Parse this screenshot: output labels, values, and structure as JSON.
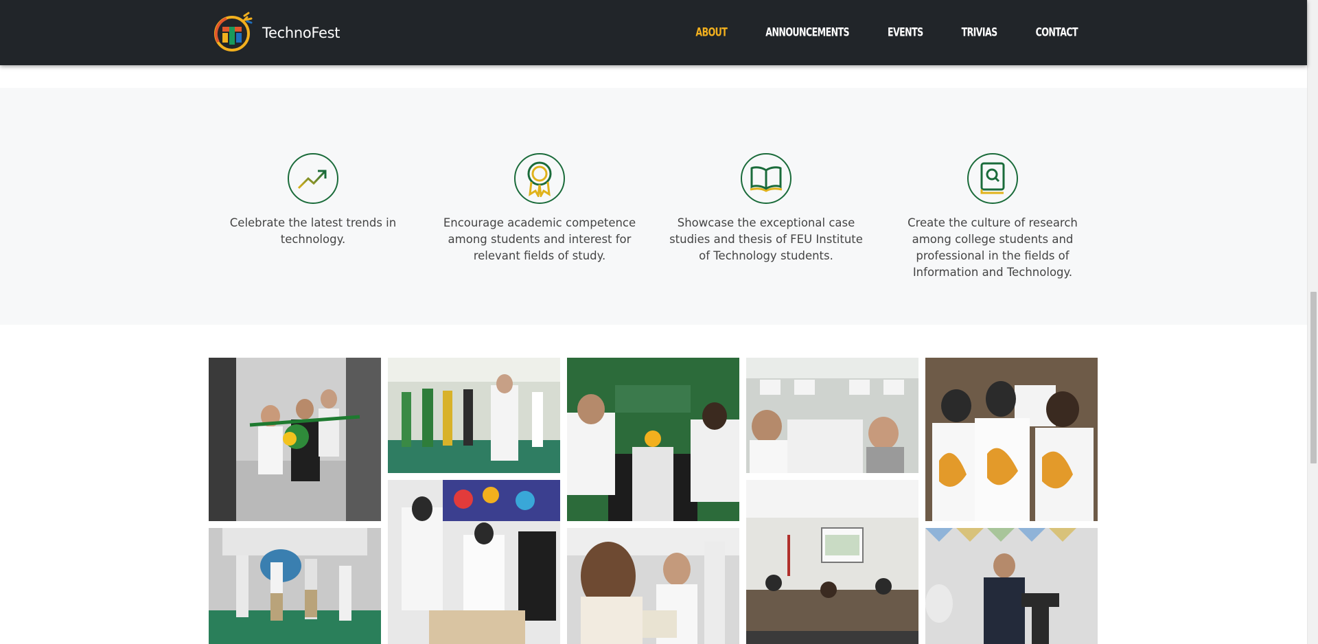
{
  "brand": {
    "name": "TechnoFest",
    "logo_icon": "technofest-logo-icon"
  },
  "nav": {
    "items": [
      {
        "label": "ABOUT",
        "active": true
      },
      {
        "label": "ANNOUNCEMENTS",
        "active": false
      },
      {
        "label": "EVENTS",
        "active": false
      },
      {
        "label": "TRIVIAS",
        "active": false
      },
      {
        "label": "CONTACT",
        "active": false
      }
    ]
  },
  "features": [
    {
      "icon": "trending-up-icon",
      "text": "Celebrate the latest trends in technology."
    },
    {
      "icon": "award-ribbon-icon",
      "text": "Encourage academic competence among students and interest for relevant fields of study."
    },
    {
      "icon": "open-book-icon",
      "text": "Showcase the exceptional case studies and thesis of FEU Institute of Technology students."
    },
    {
      "icon": "book-search-icon",
      "text": "Create the culture of research among college students and professional in the fields of Information and Technology."
    }
  ],
  "gallery": {
    "photos": [
      "ribbon-cutting-photo",
      "students-standing-photo",
      "students-dining-photo",
      "seminar-computers-photo",
      "feu-tech-shirts-photo",
      "dance-performance-photo",
      "sinulog-project-photo",
      "speaker-mic-photo",
      "lecture-room-photo",
      "podium-speaker-photo"
    ]
  },
  "colors": {
    "navbar": "#212529",
    "accent": "#f2b01e",
    "icon_green": "#1a6b3a",
    "icon_gold": "#e0b21a",
    "section_bg": "#f7f8f9"
  }
}
